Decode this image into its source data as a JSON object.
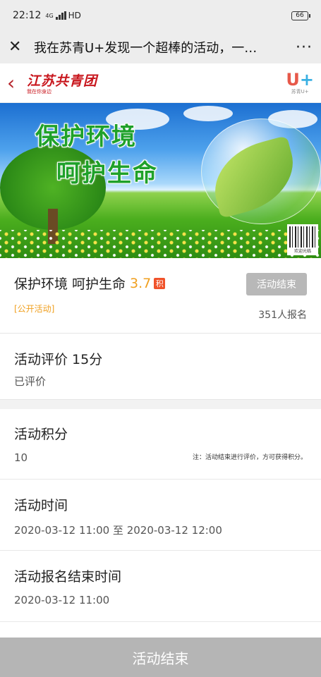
{
  "status": {
    "time": "22:12",
    "net": "4G",
    "hd": "HD",
    "battery": "66"
  },
  "titlebar": {
    "title": "我在苏青U+发现一个超棒的活动，一…",
    "more": "···"
  },
  "brand": {
    "logo_main": "江苏共青团",
    "logo_sub": "我在你身边",
    "u_cap": "苏青U+"
  },
  "banner": {
    "slogan_1": "保护环境",
    "slogan_2": "呵护生命",
    "qr_caption": "欢迎光临"
  },
  "activity": {
    "name": "保护环境 呵护生命",
    "score": "3.7",
    "points_badge": "积",
    "status_button": "活动结束",
    "tag": "[公开活动]",
    "signup_count": "351人报名"
  },
  "evaluation": {
    "title": "活动评价 15分",
    "state": "已评价"
  },
  "points": {
    "label": "活动积分",
    "value": "10",
    "note": "注：活动结束进行评价，方可获得积分。"
  },
  "time": {
    "label": "活动时间",
    "value": "2020-03-12 11:00 至 2020-03-12 12:00"
  },
  "signup_end": {
    "label": "活动报名结束时间",
    "value": "2020-03-12 11:00"
  },
  "bottom": {
    "label": "活动结束"
  }
}
